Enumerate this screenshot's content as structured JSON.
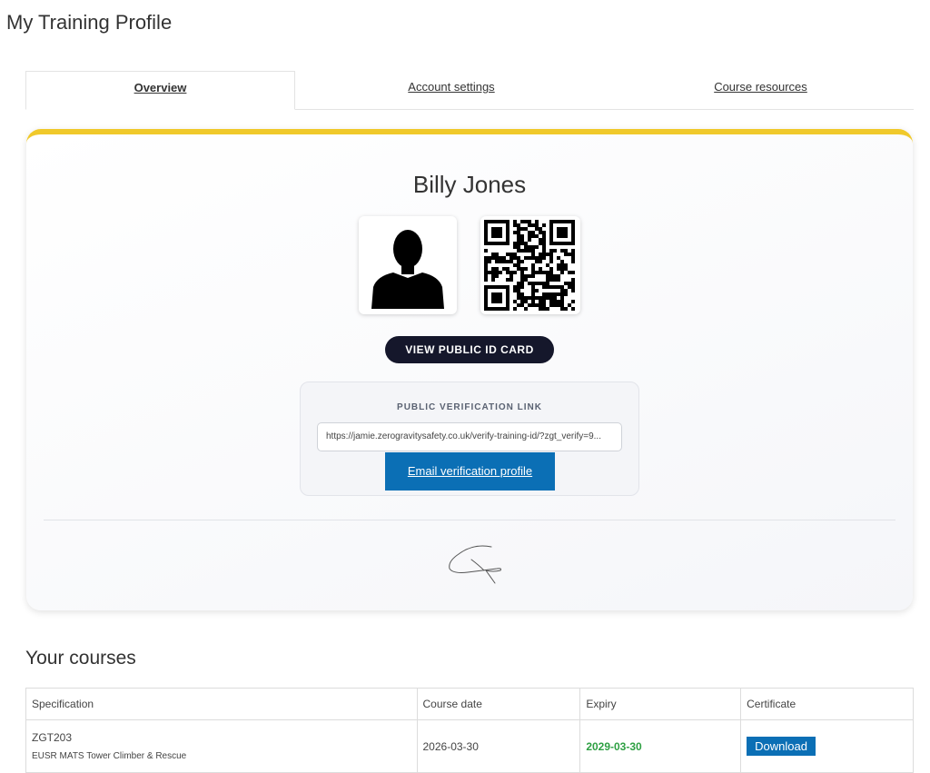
{
  "page": {
    "title": "My Training Profile"
  },
  "tabs": [
    {
      "label": "Overview",
      "active": true
    },
    {
      "label": "Account settings",
      "active": false
    },
    {
      "label": "Course resources",
      "active": false
    }
  ],
  "profile": {
    "name": "Billy Jones",
    "id_card_button": "VIEW PUBLIC ID CARD",
    "verification": {
      "label": "PUBLIC VERIFICATION LINK",
      "link": "https://jamie.zerogravitysafety.co.uk/verify-training-id/?zgt_verify=9...",
      "email_button": "Email verification profile"
    }
  },
  "courses": {
    "title": "Your courses",
    "columns": [
      "Specification",
      "Course date",
      "Expiry",
      "Certificate"
    ],
    "rows": [
      {
        "code": "ZGT203",
        "name": "EUSR MATS Tower Climber & Rescue",
        "course_date": "2026-03-30",
        "expiry": "2029-03-30",
        "certificate": "Download"
      }
    ]
  },
  "colors": {
    "accent": "#f0c92b",
    "primary": "#0b6fb5",
    "dark": "#15172b",
    "valid": "#2ea043"
  }
}
